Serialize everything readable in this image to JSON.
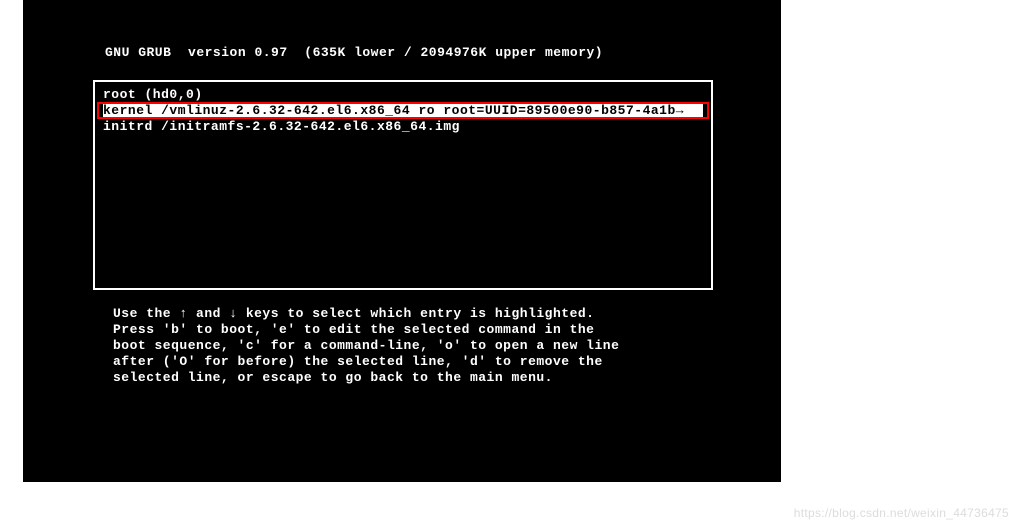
{
  "header": {
    "title": "GNU GRUB",
    "version_label": "version 0.97",
    "memory": "(635K lower / 2094976K upper memory)"
  },
  "entries": {
    "root": "root (hd0,0)",
    "kernel": "kernel /vmlinuz-2.6.32-642.el6.x86_64 ro root=UUID=89500e90-b857-4a1b",
    "kernel_arrow": "→",
    "initrd": "initrd /initramfs-2.6.32-642.el6.x86_64.img"
  },
  "help": {
    "l1": "Use the ↑ and ↓ keys to select which entry is highlighted.",
    "l2": "Press 'b' to boot, 'e' to edit the selected command in the",
    "l3": "boot sequence, 'c' for a command-line, 'o' to open a new line",
    "l4": "after ('O' for before) the selected line, 'd' to remove the",
    "l5": "selected line, or escape to go back to the main menu."
  },
  "watermark": "https://blog.csdn.net/weixin_44736475"
}
